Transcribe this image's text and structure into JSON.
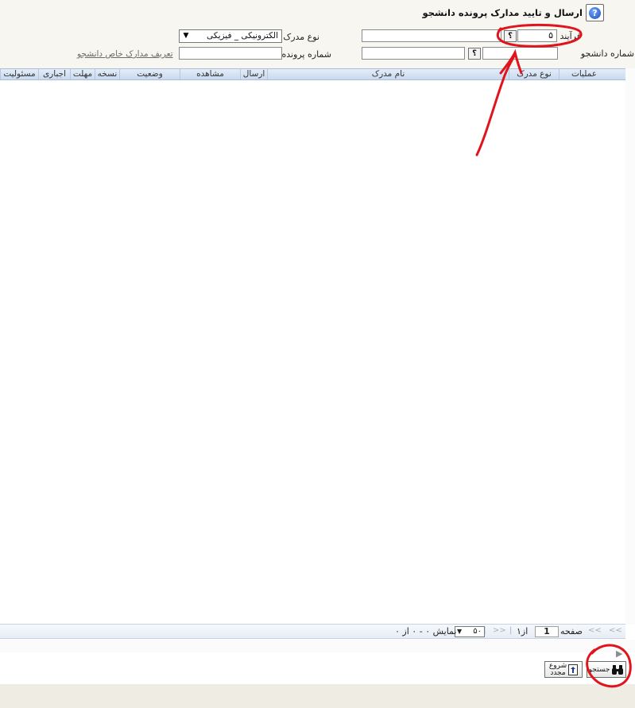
{
  "header": {
    "title": "ارسال و تایید مدارک پرونده دانشجو",
    "help_icon": "question-circle-icon",
    "help_glyph": "?"
  },
  "form": {
    "process_label": "فرآیند",
    "process_value": "۵",
    "student_number_label": "شماره دانشجو",
    "student_number_value": "",
    "doc_type_label": "نوع مدرک",
    "doc_type_value": "الکترونیکی _ فیزیکی",
    "file_number_label": "شماره پرونده",
    "file_number_value": "",
    "define_docs_link": "تعریف مدارک خاص دانشجو",
    "lookup_glyph": "؟"
  },
  "grid": {
    "columns": [
      "عملیات",
      "نوع مدرک",
      "نام مدرک",
      "ارسال",
      "مشاهده",
      "وضعیت",
      "نسخه",
      "مهلت",
      "اجباری",
      "مسئولیت"
    ]
  },
  "pager": {
    "page_label": "صفحه",
    "page_value": "1",
    "of_label": "از۱",
    "page_size": "۵۰",
    "display_text": "نمایش ۰ - ۰ از ۰"
  },
  "buttons": {
    "restart_label_1": "شروع",
    "restart_label_2": "مجدد",
    "search_label": "جستجو",
    "restart_icon": "restart-icon",
    "search_icon": "binoculars-icon"
  },
  "colors": {
    "annotation": "#e0141c",
    "grid_header": "#c9d9ee"
  }
}
